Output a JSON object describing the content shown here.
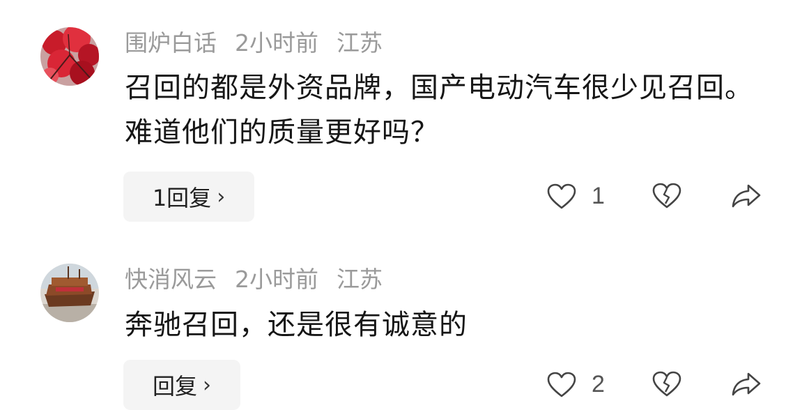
{
  "comments": [
    {
      "username": "围炉白话",
      "time": "2小时前",
      "location": "江苏",
      "text": "召回的都是外资品牌，国产电动汽车很少见召回。难道他们的质量更好吗？",
      "reply_label": "1回复",
      "like_count": "1",
      "avatar_icon": "red-maple-leaves-avatar"
    },
    {
      "username": "快消风云",
      "time": "2小时前",
      "location": "江苏",
      "text": "奔驰召回，还是很有诚意的",
      "reply_label": "回复",
      "like_count": "2",
      "avatar_icon": "wooden-boat-avatar"
    }
  ],
  "icons": {
    "like": "heart-icon",
    "dislike": "broken-heart-icon",
    "share": "share-arrow-icon",
    "reply_chevron": "chevron-right-icon"
  },
  "colors": {
    "meta_text": "#9a9a9a",
    "body_text": "#161616",
    "reply_bg": "#f4f4f4"
  }
}
